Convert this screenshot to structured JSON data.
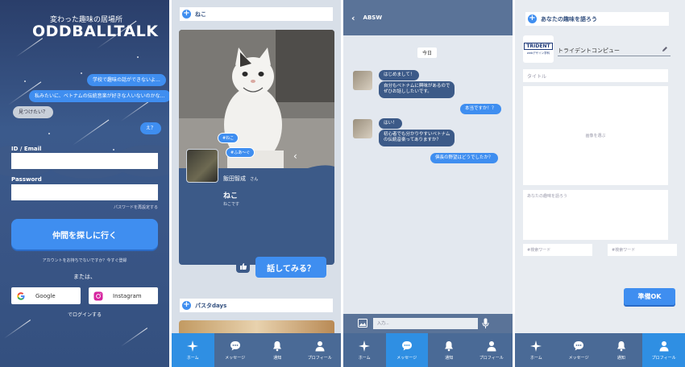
{
  "login": {
    "tagline": "変わった趣味の居場所",
    "logo": "ODDBALLTALK",
    "bubbles": [
      "学校で趣味の話ができないよ…",
      "私みたいに、ベトナムの伝統音楽が好きな人いないのかな…",
      "見つけたい？",
      "え？"
    ],
    "id_label": "ID / Email",
    "password_label": "Password",
    "forgot": "パスワードを再設定する",
    "cta": "仲間を探しに行く",
    "register": "アカウントをお持ちでないですか？今すぐ登録",
    "or": "または、",
    "google": "Google",
    "instagram": "Instagram",
    "login_with": "でログインする"
  },
  "feed": {
    "section1": "ねこ",
    "tags": [
      "#ねこ",
      "#ふあ〜ぐ"
    ],
    "user_name": "飯田智成",
    "user_suffix": "さん",
    "post_title": "ねこ",
    "post_body": "ねこです",
    "talk_button": "話してみる？",
    "section2": "パスタdays"
  },
  "chat": {
    "title": "ABSW",
    "day": "今日",
    "messages": [
      {
        "dir": "in",
        "text": "はじめまして！"
      },
      {
        "dir": "in",
        "text": "自分もベトナムに興味があるので\nぜひお話ししたいです。"
      },
      {
        "dir": "out",
        "text": "本当ですか！？"
      },
      {
        "dir": "in",
        "text": "はい！"
      },
      {
        "dir": "in",
        "text": "初心者でも分かりやすいベトナム\nの伝統音楽ってありますか？"
      },
      {
        "dir": "out",
        "text": "倶長の野望はどうでしたか？"
      }
    ],
    "input_placeholder": "入力..."
  },
  "compose": {
    "header": "あなたの趣味を語ろう",
    "community": "トライデントコンピュー",
    "community_logo": "TRIDENT",
    "community_logo_sub": "webデザイン学科",
    "title_placeholder": "タイトル",
    "image_label": "画像を選ぶ",
    "body_placeholder": "あなたの趣味を語ろう",
    "keyword1": "#検索ワード",
    "keyword2": "#検索ワード",
    "submit": "準備OK"
  },
  "nav": [
    "ホーム",
    "メッセージ",
    "通知",
    "プロフィール"
  ],
  "colors": {
    "accent": "#3f8ef0",
    "navy": "#3c5a88",
    "nav_bg": "#4a6a96"
  }
}
